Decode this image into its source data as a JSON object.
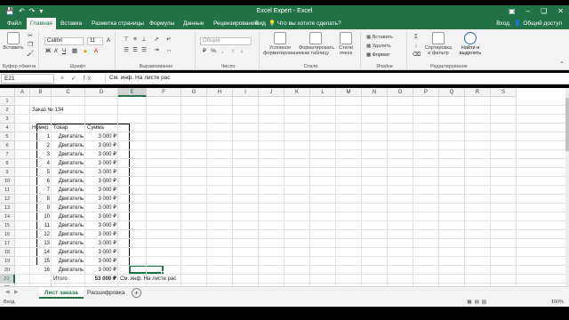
{
  "titlebar": {
    "title": "Excel Expert - Excel",
    "qat": [
      "save-icon",
      "undo-icon",
      "redo-icon",
      "customize-icon"
    ],
    "window_controls": [
      "ribbon-display-icon",
      "minimize-icon",
      "restore-icon",
      "close-icon"
    ]
  },
  "tabs": {
    "file": "Файл",
    "home": "Главная",
    "insert": "Вставка",
    "layout": "Разметка страницы",
    "formulas": "Формулы",
    "data": "Данные",
    "review": "Рецензирование",
    "view": "Вид",
    "tell_me": "Что вы хотите сделать?",
    "signin": "Вход",
    "share": "Общий доступ"
  },
  "ribbon": {
    "paste": "Вставить",
    "group_clipboard": "Буфер обмена",
    "font_name": "Calibri",
    "font_size": "11",
    "group_font": "Шрифт",
    "group_alignment": "Выравнивание",
    "number_format": "Общий",
    "group_number": "Число",
    "cond_format": "Условное форматирование",
    "format_table": "Форматировать как таблицу",
    "cell_styles": "Стили ячеек",
    "group_styles": "Стили",
    "insert": "Вставить",
    "delete": "Удалить",
    "format": "Формат",
    "group_cells": "Ячейки",
    "sort_filter": "Сортировка и фильтр",
    "find_select": "Найти и выделить",
    "group_editing": "Редактирование"
  },
  "formula_bar": {
    "name_box": "E21",
    "fx": "× ✓ fx",
    "formula": "См. инф. На листе рас"
  },
  "columns": [
    "A",
    "B",
    "C",
    "D",
    "E",
    "F",
    "G",
    "H",
    "I",
    "J",
    "K",
    "L",
    "M",
    "N",
    "O",
    "P",
    "Q",
    "R",
    "S"
  ],
  "rows": [
    "1",
    "2",
    "3",
    "4",
    "5",
    "6",
    "7",
    "8",
    "9",
    "10",
    "11",
    "12",
    "13",
    "14",
    "15",
    "16",
    "17",
    "18",
    "19",
    "20",
    "21",
    "22",
    "23"
  ],
  "cells": {
    "title": "Заказ № 134",
    "header_num": "Номер",
    "header_item": "Товар",
    "header_sum": "Сумма",
    "total_label": "Итого",
    "total_sum": "53 000 ₽",
    "e21": "См. инф. На листе рас"
  },
  "items": [
    {
      "num": "1",
      "item": "Двигатель",
      "sum": "3 000 ₽"
    },
    {
      "num": "2",
      "item": "Двигатель",
      "sum": "3 000 ₽"
    },
    {
      "num": "3",
      "item": "Двигатель",
      "sum": "3 000 ₽"
    },
    {
      "num": "4",
      "item": "Двигатель",
      "sum": "3 000 ₽"
    },
    {
      "num": "5",
      "item": "Двигатель",
      "sum": "3 000 ₽"
    },
    {
      "num": "6",
      "item": "Двигатель",
      "sum": "3 000 ₽"
    },
    {
      "num": "7",
      "item": "Двигатель",
      "sum": "3 000 ₽"
    },
    {
      "num": "8",
      "item": "Двигатель",
      "sum": "3 000 ₽"
    },
    {
      "num": "9",
      "item": "Двигатель",
      "sum": "3 000 ₽"
    },
    {
      "num": "10",
      "item": "Двигатель",
      "sum": "3 000 ₽"
    },
    {
      "num": "11",
      "item": "Двигатель",
      "sum": "3 000 ₽"
    },
    {
      "num": "12",
      "item": "Двигатель",
      "sum": "3 000 ₽"
    },
    {
      "num": "13",
      "item": "Двигатель",
      "sum": "3 000 ₽"
    },
    {
      "num": "14",
      "item": "Двигатель",
      "sum": "3 000 ₽"
    },
    {
      "num": "15",
      "item": "Двигатель",
      "sum": "3 000 ₽"
    },
    {
      "num": "16",
      "item": "Двигатель",
      "sum": "3 000 ₽"
    }
  ],
  "sheet_tabs": {
    "active": "Лист заказа",
    "second": "Расшифровка"
  },
  "status": {
    "ready": "Вход",
    "zoom": "100%"
  },
  "colors": {
    "accent": "#217346"
  }
}
